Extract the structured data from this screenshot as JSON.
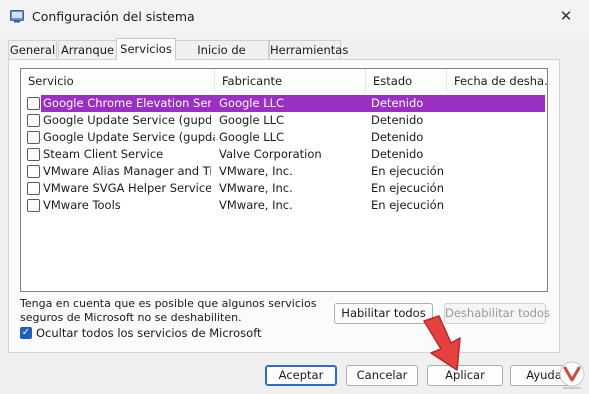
{
  "window": {
    "title": "Configuración del sistema",
    "close_label": "✕"
  },
  "tabs": [
    {
      "label": "General"
    },
    {
      "label": "Arranque"
    },
    {
      "label": "Servicios"
    },
    {
      "label": "Inicio de Windows"
    },
    {
      "label": "Herramientas"
    }
  ],
  "active_tab": "Servicios",
  "list": {
    "columns": [
      "Servicio",
      "Fabricante",
      "Estado",
      "Fecha de desha..."
    ],
    "rows": [
      {
        "service": "Google Chrome Elevation Servic...",
        "maker": "Google LLC",
        "status": "Detenido",
        "checked": false,
        "selected": true
      },
      {
        "service": "Google Update Service (gupdate)",
        "maker": "Google LLC",
        "status": "Detenido",
        "checked": false,
        "selected": false
      },
      {
        "service": "Google Update Service (gupdatem)",
        "maker": "Google LLC",
        "status": "Detenido",
        "checked": false,
        "selected": false
      },
      {
        "service": "Steam Client Service",
        "maker": "Valve Corporation",
        "status": "Detenido",
        "checked": false,
        "selected": false
      },
      {
        "service": "VMware Alias Manager and Ticke...",
        "maker": "VMware, Inc.",
        "status": "En ejecución",
        "checked": false,
        "selected": false
      },
      {
        "service": "VMware SVGA Helper Service",
        "maker": "VMware, Inc.",
        "status": "En ejecución",
        "checked": false,
        "selected": false
      },
      {
        "service": "VMware Tools",
        "maker": "VMware, Inc.",
        "status": "En ejecución",
        "checked": false,
        "selected": false
      }
    ],
    "selected_color": "#9b2fc4"
  },
  "note": {
    "line1": "Tenga en cuenta que es posible que algunos servicios",
    "line2": "seguros de Microsoft no se deshabiliten."
  },
  "hide_ms": {
    "label": "Ocultar todos los servicios de Microsoft",
    "checked": true
  },
  "buttons": {
    "enable_all": "Habilitar todos",
    "disable_all": "Deshabilitar todos",
    "accept": "Aceptar",
    "cancel": "Cancelar",
    "apply": "Aplicar",
    "help": "Ayuda"
  },
  "colors": {
    "accent": "#2b6cd1",
    "arrow": "#e8403f"
  }
}
